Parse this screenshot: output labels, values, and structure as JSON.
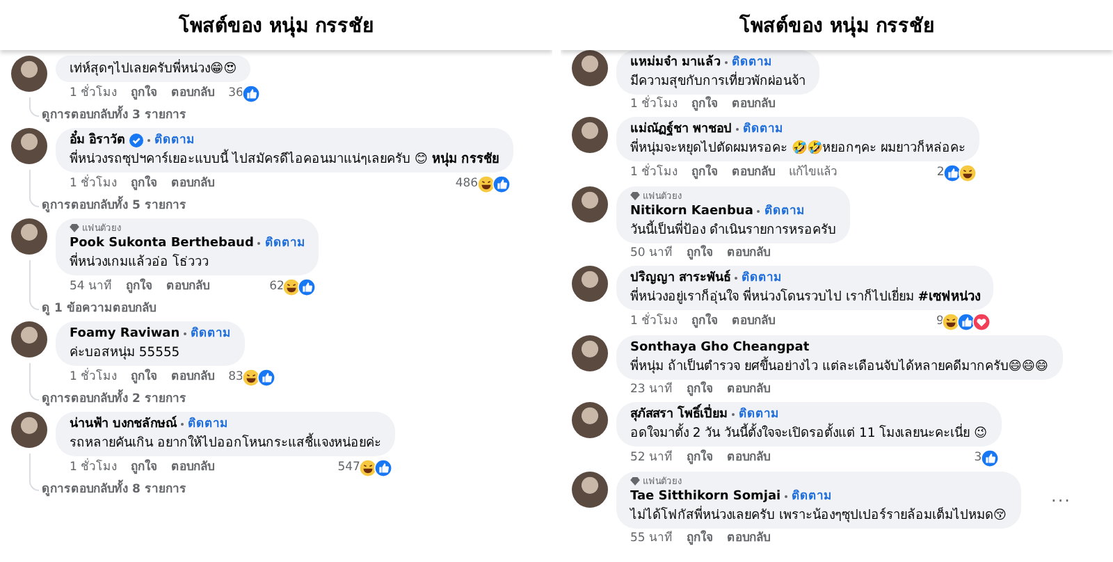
{
  "panels": [
    {
      "title": "โพสต์ของ หนุ่ม กรรชัย",
      "comments": [
        {
          "text": "เท่ห์สุดๆไปเลยครับพี่หน่วง😁😍",
          "time": "1 ชั่วโมง",
          "like": "ถูกใจ",
          "reply": "ตอบกลับ",
          "count": "36",
          "reactions": [
            {
              "kind": "like"
            }
          ],
          "replies": "ดูการตอบกลับทั้ง 3 รายการ"
        },
        {
          "author": "อั๋ม อิราวัต",
          "verified": true,
          "follow": "ติดตาม",
          "text": "พี่หน่วงรถซุปฯคาร์เยอะแบบนี้ ไปสมัครดีไอคอนมาแน่ๆเลยครับ 😊 **หนุ่ม กรรชัย**",
          "time": "1 ชั่วโมง",
          "like": "ถูกใจ",
          "reply": "ตอบกลับ",
          "count": "486",
          "reactions": [
            {
              "kind": "haha"
            },
            {
              "kind": "like"
            }
          ],
          "replies": "ดูการตอบกลับทั้ง 5 รายการ"
        },
        {
          "badge": "แฟนตัวยง",
          "author": "Pook Sukonta Berthebaud",
          "follow": "ติดตาม",
          "text": "พี่หน่วงเกมแล้วอ่อ โธ่ววว",
          "time": "54 นาที",
          "like": "ถูกใจ",
          "reply": "ตอบกลับ",
          "count": "62",
          "reactions": [
            {
              "kind": "haha"
            },
            {
              "kind": "like"
            }
          ],
          "replies": "ดู 1 ข้อความตอบกลับ"
        },
        {
          "author": "Foamy Raviwan",
          "follow": "ติดตาม",
          "text": "ค่ะบอสหนุ่ม 55555",
          "time": "1 ชั่วโมง",
          "like": "ถูกใจ",
          "reply": "ตอบกลับ",
          "count": "83",
          "reactions": [
            {
              "kind": "haha"
            },
            {
              "kind": "like"
            }
          ],
          "replies": "ดูการตอบกลับทั้ง 2 รายการ"
        },
        {
          "author": "น่านฟ้า บงกชลักษณ์",
          "follow": "ติดตาม",
          "text": "รถหลายคันเกิน อยากให้ไปออกโหนกระแสชี้แจงหน่อยค่ะ",
          "time": "1 ชั่วโมง",
          "like": "ถูกใจ",
          "reply": "ตอบกลับ",
          "count": "547",
          "reactions": [
            {
              "kind": "haha"
            },
            {
              "kind": "like"
            }
          ],
          "replies": "ดูการตอบกลับทั้ง 8 รายการ"
        }
      ]
    },
    {
      "title": "โพสต์ของ หนุ่ม กรรชัย",
      "comments": [
        {
          "author": "แหม่มจ๋า มาแล้ว",
          "follow": "ติดตาม",
          "text": "มีความสุขกับการเที่ยวพักผ่อนจ้า",
          "time": "1 ชั่วโมง",
          "like": "ถูกใจ",
          "reply": "ตอบกลับ"
        },
        {
          "author": "แม่ณัฏฐ์ชา พาชอป",
          "follow": "ติดตาม",
          "text": "พี่หนุ่มจะหยุดไปตัดผมหรอคะ 🤣🤣หยอกๆคะ ผมยาวก็หล่อคะ",
          "time": "1 ชั่วโมง",
          "like": "ถูกใจ",
          "reply": "ตอบกลับ",
          "edited": "แก้ไขแล้ว",
          "count": "2",
          "reactions": [
            {
              "kind": "like"
            },
            {
              "kind": "haha"
            }
          ]
        },
        {
          "badge": "แฟนตัวยง",
          "author": "Nitikorn Kaenbua",
          "follow": "ติดตาม",
          "text": "วันนี้เป็นพี่ป้อง ดำเนินรายการหรอครับ",
          "time": "50 นาที",
          "like": "ถูกใจ",
          "reply": "ตอบกลับ"
        },
        {
          "author": "ปริญญา สาระพันธ์",
          "follow": "ติดตาม",
          "text": "พี่หน่วงอยู่เราก็อุ่นใจ พี่หน่วงโดนรวบไป เราก็ไปเยี่ยม **#เซฟหน่วง**",
          "time": "1 ชั่วโมง",
          "like": "ถูกใจ",
          "reply": "ตอบกลับ",
          "count": "9",
          "reactions": [
            {
              "kind": "haha"
            },
            {
              "kind": "like"
            },
            {
              "kind": "love"
            }
          ]
        },
        {
          "author": "Sonthaya Gho Cheangpat",
          "text": "พี่หนุ่ม ถ้าเป็นตำรวจ ยศขึ้นอย่างไว แต่ละเดือนจับได้หลายคดีมากครับ😄😄😄",
          "time": "23 นาที",
          "like": "ถูกใจ",
          "reply": "ตอบกลับ"
        },
        {
          "author": "สุภัสสรา โพธิ์เปี่ยม",
          "follow": "ติดตาม",
          "text": "อดใจมาตั้ง 2 วัน วันนี้ตั้งใจจะเปิดรอตั้งแต่ 11 โมงเลยนะคะเนี่ย 😉",
          "time": "52 นาที",
          "like": "ถูกใจ",
          "reply": "ตอบกลับ",
          "count": "3",
          "reactions": [
            {
              "kind": "like"
            }
          ]
        },
        {
          "badge": "แฟนตัวยง",
          "author": "Tae Sitthikorn Somjai",
          "follow": "ติดตาม",
          "text": "ไม่ได้โฟกัสพี่หน่วงเลยครับ เพราะน้องๆซุปเปอร์รายล้อมเต็มไปหมด😚",
          "time": "55 นาที",
          "like": "ถูกใจ",
          "reply": "ตอบกลับ",
          "menu": "···"
        }
      ]
    }
  ]
}
